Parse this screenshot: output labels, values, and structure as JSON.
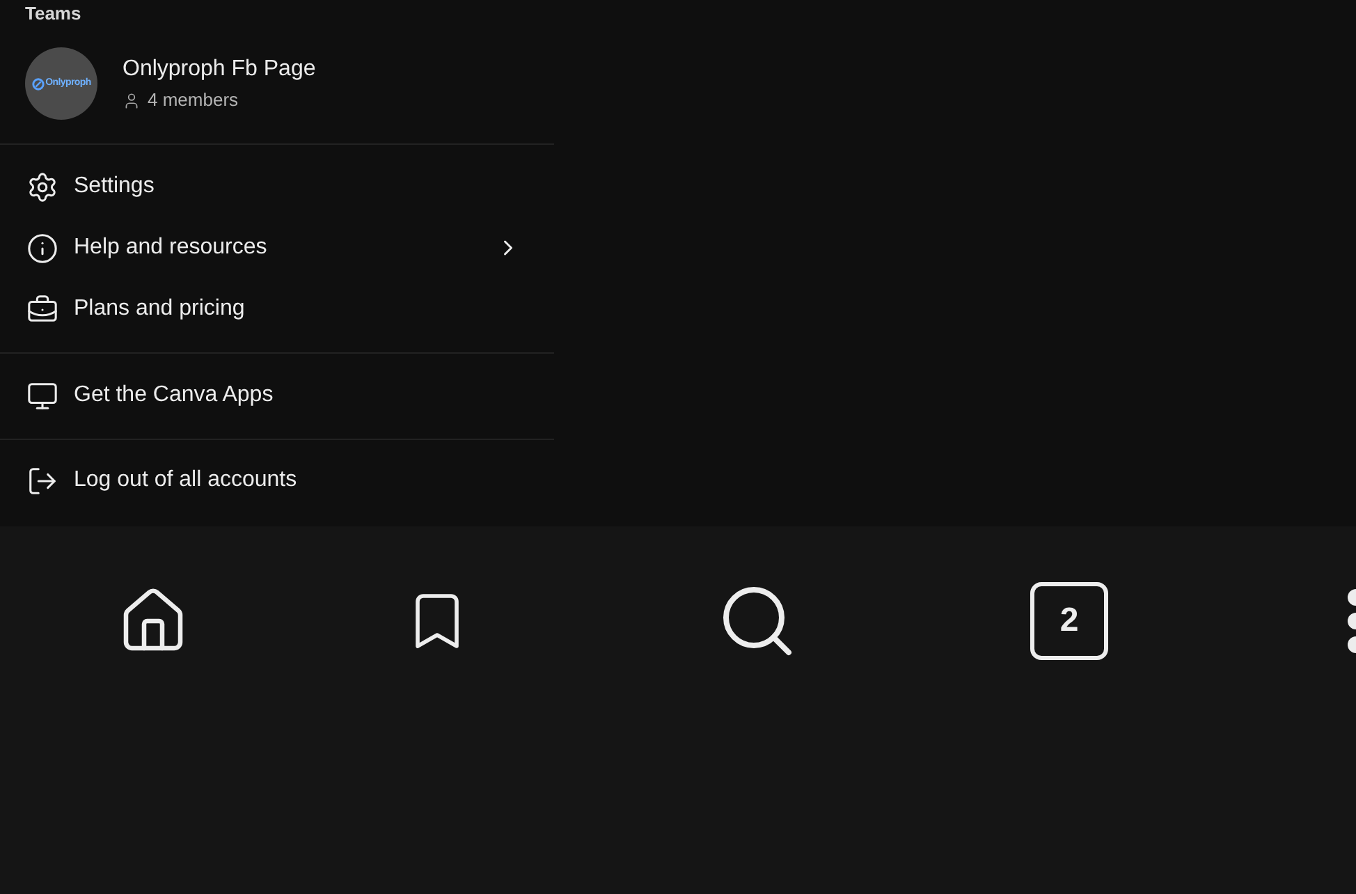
{
  "sidebar": {
    "section_title": "Teams",
    "team": {
      "logo_text": "Onlyproph",
      "name": "Onlyproph Fb Page",
      "members": "4 members"
    },
    "menu_groups": [
      {
        "items": [
          {
            "kind": "settings",
            "label": "Settings",
            "has_submenu": false
          },
          {
            "kind": "help",
            "label": "Help and resources",
            "has_submenu": true
          },
          {
            "kind": "plans",
            "label": "Plans and pricing",
            "has_submenu": false
          }
        ]
      },
      {
        "items": [
          {
            "kind": "apps",
            "label": "Get the Canva Apps",
            "has_submenu": false
          }
        ]
      },
      {
        "items": [
          {
            "kind": "logout",
            "label": "Log out of all accounts",
            "has_submenu": false
          }
        ]
      }
    ]
  },
  "bottom_nav": [
    {
      "kind": "home"
    },
    {
      "kind": "bookmark"
    },
    {
      "kind": "search"
    },
    {
      "kind": "tabs",
      "count": "2"
    },
    {
      "kind": "more"
    }
  ]
}
